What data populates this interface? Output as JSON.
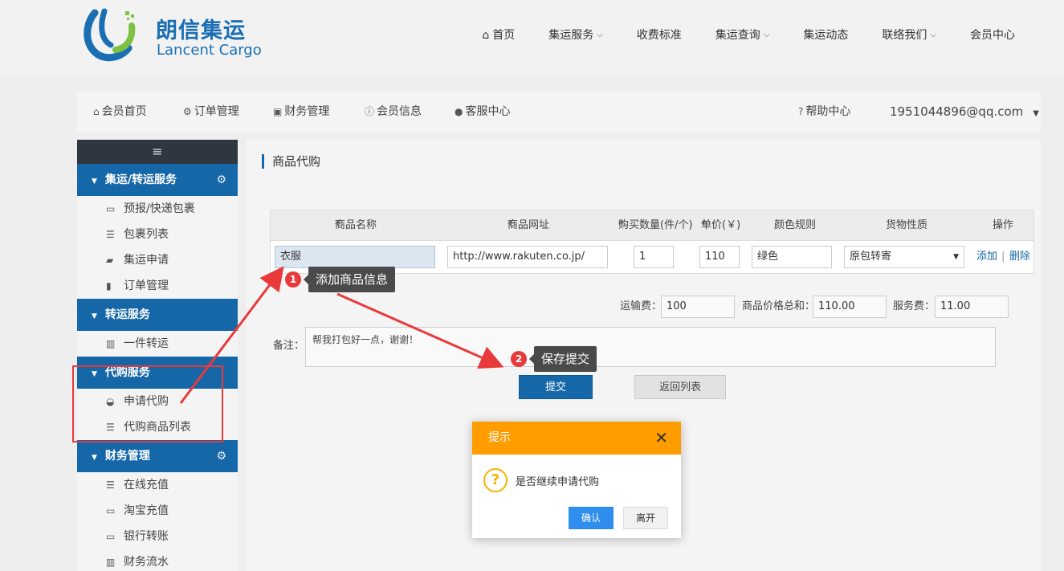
{
  "header": {
    "logo_cn": "朗信集运",
    "logo_en": "Lancent Cargo",
    "nav": [
      {
        "label": "首页"
      },
      {
        "label": "集运服务"
      },
      {
        "label": "收费标准"
      },
      {
        "label": "集运查询"
      },
      {
        "label": "集运动态"
      },
      {
        "label": "联络我们"
      },
      {
        "label": "会员中心"
      }
    ]
  },
  "member_bar": {
    "home": "会员首页",
    "orders": "订单管理",
    "finance": "财务管理",
    "info": "会员信息",
    "service": "客服中心",
    "help": "帮助中心",
    "user": "1951044896@qq.com"
  },
  "sidebar": {
    "toggle_icon": "≡",
    "sections": [
      {
        "title": "集运/转运服务",
        "items": [
          "预报/快递包裹",
          "包裹列表",
          "集运申请",
          "订单管理"
        ]
      },
      {
        "title": "转运服务",
        "items": [
          "一件转运"
        ]
      },
      {
        "title": "代购服务",
        "items": [
          "申请代购",
          "代购商品列表"
        ]
      },
      {
        "title": "财务管理",
        "items": [
          "在线充值",
          "淘宝充值",
          "银行转账",
          "财务流水"
        ]
      }
    ]
  },
  "content": {
    "title": "商品代购",
    "table": {
      "headers": {
        "name": "商品名称",
        "url": "商品网址",
        "qty": "购买数量(件/个)",
        "price": "单价(￥)",
        "color": "颜色规则",
        "nature": "货物性质",
        "ops": "操作"
      },
      "row": {
        "name": "衣服",
        "url": "http://www.rakuten.co.jp/",
        "qty": "1",
        "price": "110",
        "color": "绿色",
        "nature": "原包转寄",
        "add": "添加",
        "sep": "|",
        "delete": "删除"
      }
    },
    "fees": {
      "shipping_label": "运输费：",
      "shipping_value": "100",
      "total_label": "商品价格总和：",
      "total_value": "110.00",
      "service_label": "服务费：",
      "service_value": "11.00"
    },
    "remark_label": "备注：",
    "remark_value": "帮我打包好一点，谢谢！",
    "submit": "提交",
    "back": "返回列表"
  },
  "annotations": {
    "step1_num": "1",
    "step1_text": "添加商品信息",
    "step2_num": "2",
    "step2_text": "保存提交"
  },
  "dialog": {
    "title": "提示",
    "close": "✕",
    "message": "是否继续申请代购",
    "ok": "确认",
    "cancel": "离开"
  },
  "colors": {
    "brand_blue": "#1667a8",
    "dialog_orange": "#ff9c00",
    "annotation_red": "#e83a3a"
  }
}
